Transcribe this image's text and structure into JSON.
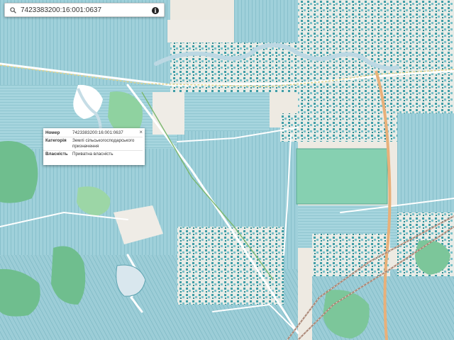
{
  "search": {
    "value": "7423383200:16:001:0637",
    "icon": "search-icon",
    "info_icon": "info-icon",
    "info_glyph": "i"
  },
  "popup": {
    "close_label": "×",
    "rows": [
      {
        "key": "Номер",
        "value": "7423383200:16:001:0637"
      },
      {
        "key": "Категорія",
        "value": "Землі сільськогосподарського призначення"
      },
      {
        "key": "Власність",
        "value": "Приватна власність"
      }
    ]
  },
  "colors": {
    "parcel": "#a3d3dc",
    "parcel_edge": "#5fa4b1",
    "green": "#7cc69a",
    "road": "#ffffff",
    "rail": "#a98472",
    "river": "#c7dbe4"
  }
}
